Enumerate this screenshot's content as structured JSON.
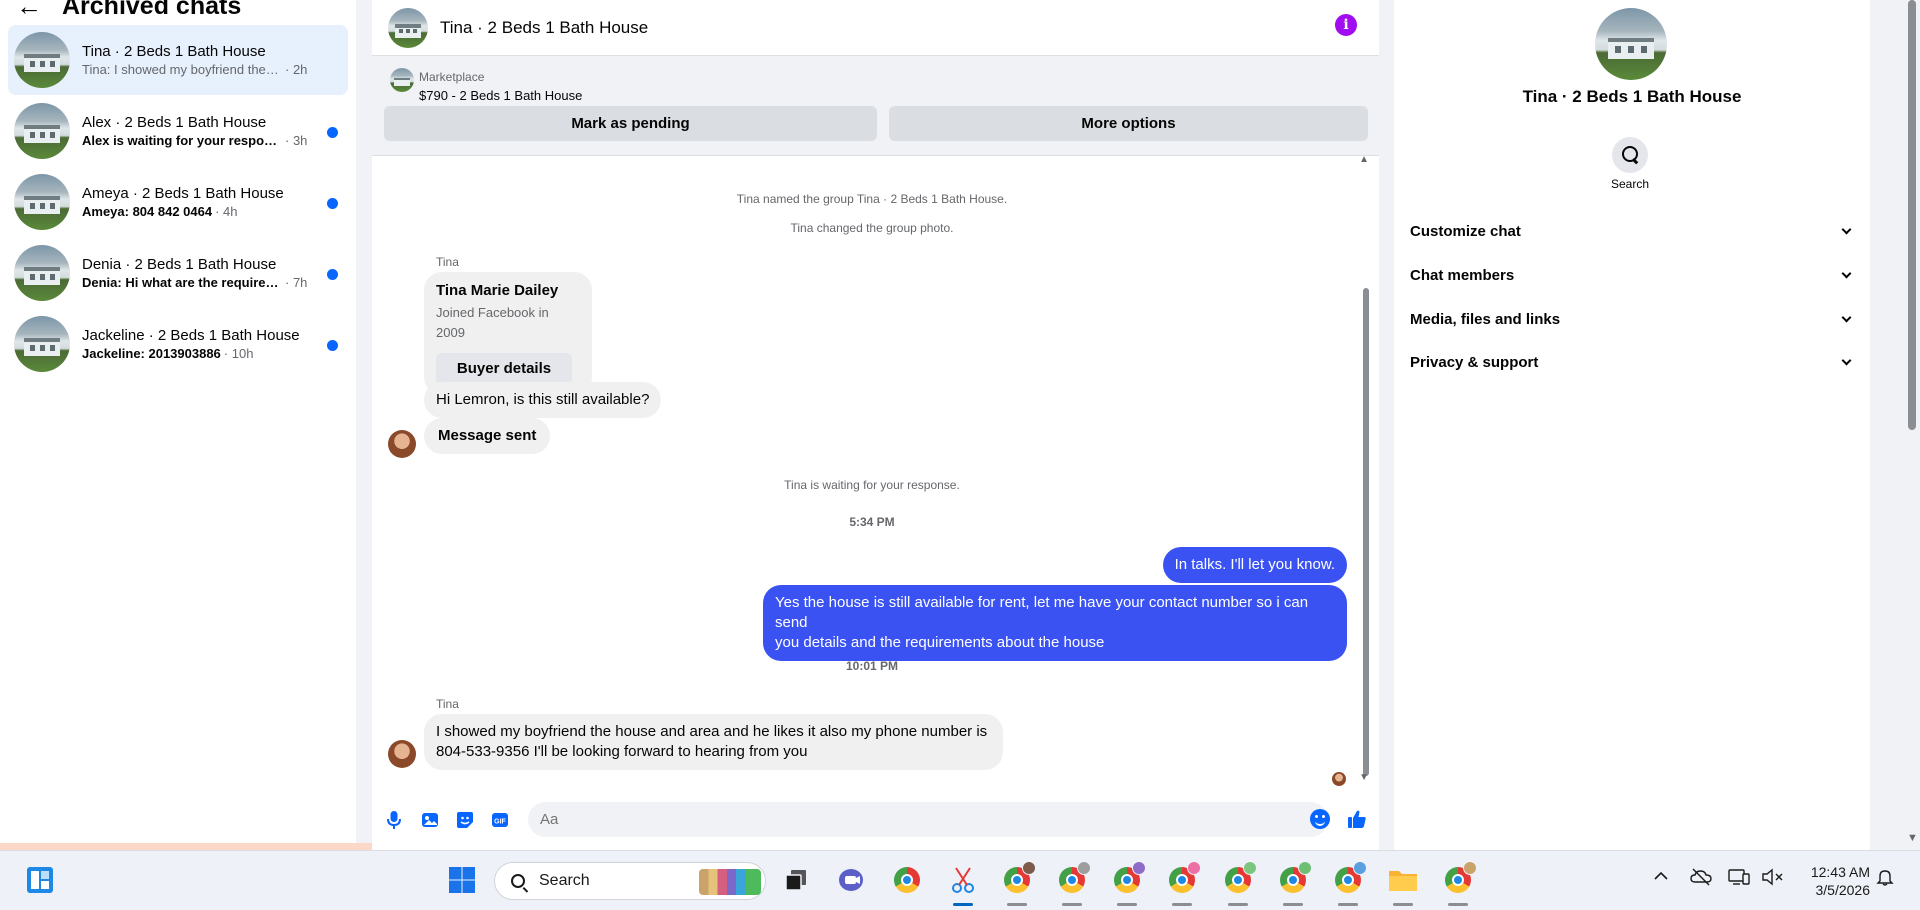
{
  "sidebar": {
    "back_glyph": "←",
    "title": "Archived chats",
    "chats": [
      {
        "name": "Tina · 2 Beds 1 Bath House",
        "preview": "Tina: I showed my boyfriend the hous...",
        "time": "· 2h",
        "unread": false,
        "selected": true
      },
      {
        "name": "Alex · 2 Beds 1 Bath House",
        "preview": "Alex is waiting for your response.",
        "time": "· 3h",
        "unread": true,
        "selected": false
      },
      {
        "name": "Ameya · 2 Beds 1 Bath House",
        "preview": "Ameya: 804 842 0464",
        "time": "· 4h",
        "unread": true,
        "selected": false
      },
      {
        "name": "Denia · 2 Beds 1 Bath House",
        "preview": "Denia: Hi what are the requiremen...",
        "time": "· 7h",
        "unread": true,
        "selected": false
      },
      {
        "name": "Jackeline · 2 Beds 1 Bath House",
        "preview": "Jackeline: 2013903886",
        "time": "· 10h",
        "unread": true,
        "selected": false
      }
    ]
  },
  "conversation": {
    "title": "Tina · 2 Beds 1 Bath House",
    "info_glyph": "i",
    "marketplace": {
      "source": "Marketplace",
      "listing": "$790 - 2 Beds 1 Bath House",
      "mark_pending": "Mark as pending",
      "more_options": "More options"
    },
    "events": {
      "named_group": "Tina named the group Tina · 2 Beds 1 Bath House.",
      "changed_photo": "Tina changed the group photo.",
      "waiting": "Tina is waiting for your response.",
      "time1": "5:34 PM",
      "time2": "10:01 PM"
    },
    "sender_name": "Tina",
    "card": {
      "name": "Tina Marie Dailey",
      "joined": "Joined Facebook in 2009",
      "button": "Buyer details"
    },
    "msg_hi": "Hi Lemron, is this still available?",
    "msg_sent": "Message sent",
    "out_1": "In talks. I'll let you know.",
    "out_2_line1": "Yes the house is still available for rent, let me have your contact number so i can send",
    "out_2_line2": "you details and the requirements about the house",
    "in_last_line1": "I showed my boyfriend the house and area and he likes it also my phone number is",
    "in_last_line2": "804-533-9356 I'll be looking forward to hearing from you",
    "composer_placeholder": "Aa"
  },
  "details": {
    "name": "Tina · 2 Beds 1 Bath House",
    "search_label": "Search",
    "sections": [
      "Customize chat",
      "Chat members",
      "Media, files and links",
      "Privacy & support"
    ]
  },
  "taskbar": {
    "search_label": "Search",
    "time": "12:43 AM",
    "date": "3/5/2026"
  },
  "colors": {
    "accent": "#0866ff",
    "outgoing_bubble": "#3a52f2",
    "info_icon": "#a10df0",
    "selected_chat": "#e7f0fd"
  }
}
